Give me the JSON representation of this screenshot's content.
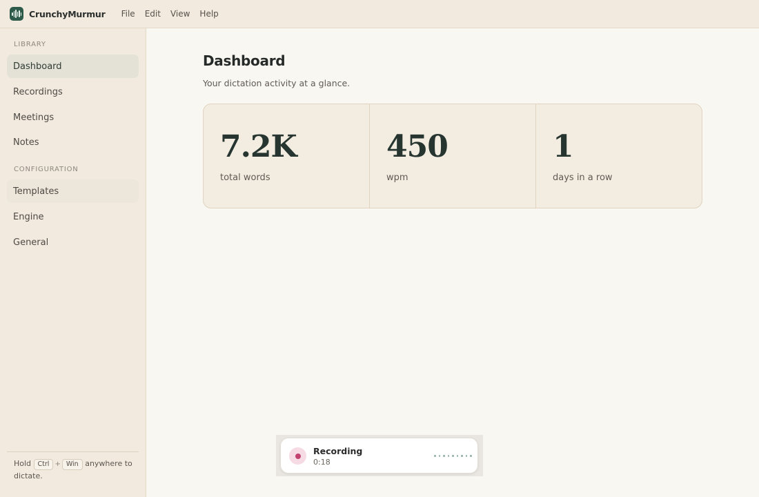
{
  "app": {
    "name": "CrunchyMurmur",
    "menu": [
      "File",
      "Edit",
      "View",
      "Help"
    ]
  },
  "sidebar": {
    "library_label": "LIBRARY",
    "library_items": [
      "Dashboard",
      "Recordings",
      "Meetings",
      "Notes"
    ],
    "config_label": "CONFIGURATION",
    "config_items": [
      "Templates",
      "Engine",
      "General"
    ],
    "active_item": "Dashboard",
    "hint": {
      "prefix": "Hold",
      "key1": "Ctrl",
      "plus": "+",
      "key2": "Win",
      "suffix": "anywhere to dictate."
    }
  },
  "main": {
    "title": "Dashboard",
    "subtitle": "Your dictation activity at a glance.",
    "stats": [
      {
        "value": "7.2K",
        "label": "total words"
      },
      {
        "value": "450",
        "label": "wpm"
      },
      {
        "value": "1",
        "label": "days in a row"
      }
    ]
  },
  "recording": {
    "title": "Recording",
    "elapsed": "0:18"
  },
  "colors": {
    "accent": "#2e5a4a",
    "recording": "#c2416f"
  }
}
